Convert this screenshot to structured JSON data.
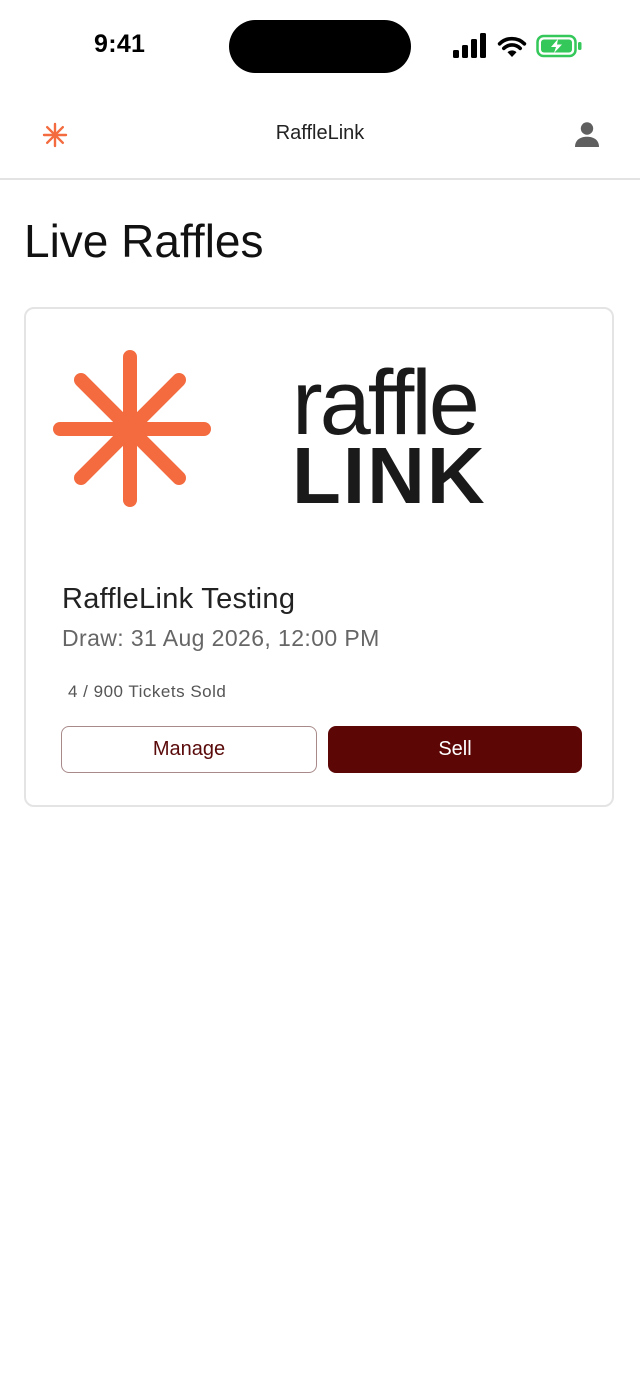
{
  "status_bar": {
    "time": "9:41"
  },
  "header": {
    "title": "RaffleLink",
    "logo_icon": "asterisk-logo-icon",
    "profile_icon": "person-icon"
  },
  "page": {
    "title": "Live Raffles"
  },
  "raffles": [
    {
      "logo_text_top": "raffle",
      "logo_text_bottom": "LINK",
      "name": "RaffleLink Testing",
      "draw": "Draw: 31 Aug 2026, 12:00 PM",
      "tickets_sold": "4 / 900 Tickets Sold",
      "manage_label": "Manage",
      "sell_label": "Sell"
    }
  ],
  "colors": {
    "brand_orange": "#f36b3f",
    "primary_maroon": "#5c0606",
    "battery_green": "#34c759"
  }
}
